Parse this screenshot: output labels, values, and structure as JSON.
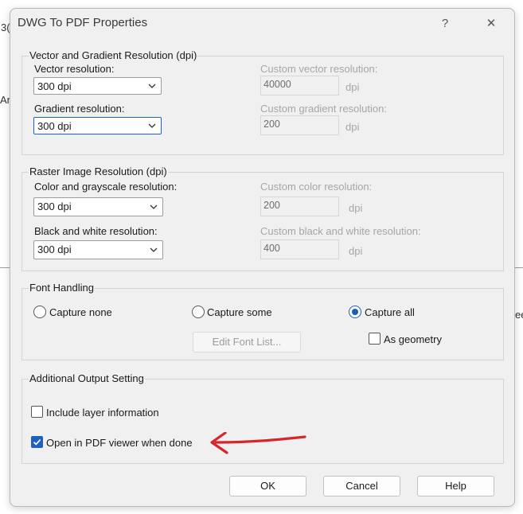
{
  "background": {
    "frag_a": "3(",
    "frag_b": "Ar",
    "frag_c": "ee"
  },
  "dialog": {
    "title": "DWG To PDF Properties",
    "help_glyph": "?",
    "close_glyph": "✕"
  },
  "vector_group": {
    "title": "Vector and Gradient Resolution (dpi)",
    "vector_label": "Vector resolution:",
    "vector_value": "300 dpi",
    "gradient_label": "Gradient resolution:",
    "gradient_value": "300 dpi",
    "custom_vector_label": "Custom vector resolution:",
    "custom_vector_value": "40000",
    "custom_gradient_label": "Custom gradient resolution:",
    "custom_gradient_value": "200",
    "unit": "dpi"
  },
  "raster_group": {
    "title": "Raster Image Resolution (dpi)",
    "color_label": "Color and grayscale resolution:",
    "color_value": "300 dpi",
    "bw_label": "Black and white resolution:",
    "bw_value": "300 dpi",
    "custom_color_label": "Custom color resolution:",
    "custom_color_value": "200",
    "custom_bw_label": "Custom black and white resolution:",
    "custom_bw_value": "400",
    "unit": "dpi"
  },
  "font_group": {
    "title": "Font Handling",
    "capture_none": "Capture none",
    "capture_some": "Capture some",
    "capture_all": "Capture all",
    "selected": "Capture all",
    "edit_font_list": "Edit Font List...",
    "as_geometry": "As geometry",
    "as_geometry_checked": false
  },
  "output_group": {
    "title": "Additional Output Setting",
    "include_layer": "Include layer information",
    "include_layer_checked": false,
    "open_viewer": "Open in PDF viewer when done",
    "open_viewer_checked": true
  },
  "buttons": {
    "ok": "OK",
    "cancel": "Cancel",
    "help": "Help"
  },
  "colors": {
    "accent": "#1a5fb4",
    "annotation_arrow": "#d7262b"
  }
}
